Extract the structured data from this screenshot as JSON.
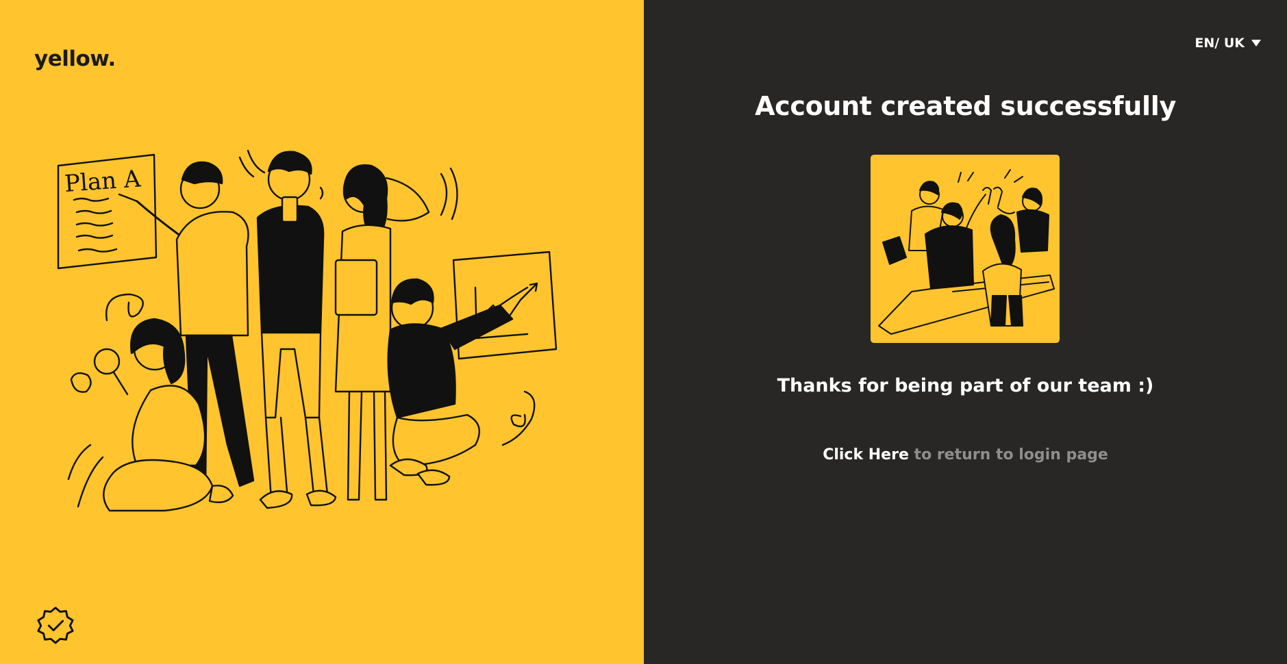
{
  "brand": {
    "logo_text": "yellow."
  },
  "language": {
    "selected": "EN/ UK"
  },
  "illustration": {
    "whiteboard_text": "Plan A"
  },
  "main": {
    "title": "Account created successfully",
    "thanks_message": "Thanks for being part of our team :)",
    "login_link_label": "Click Here",
    "login_link_suffix": "to return to login page"
  },
  "icons": {
    "language": "chevron-down-icon",
    "badge": "verified-badge-icon"
  },
  "colors": {
    "brand_yellow": "#FFC42E",
    "panel_dark": "#282726",
    "text_light": "#ffffff",
    "text_muted": "#8f8e8c",
    "ink": "#1b1b1b"
  }
}
